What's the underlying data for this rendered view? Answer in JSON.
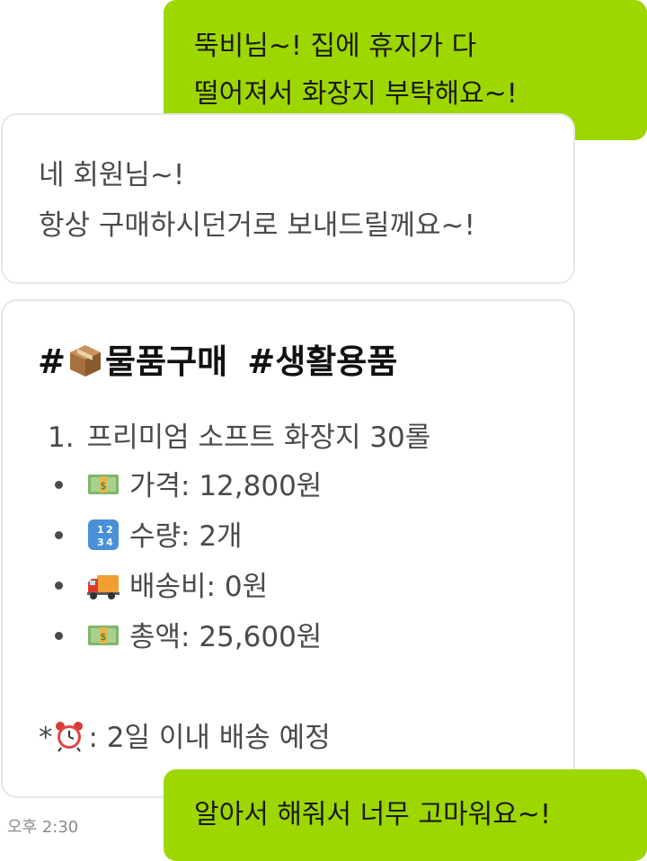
{
  "messages": {
    "outgoing_1": {
      "line1": "뚝비님~! 집에 휴지가 다",
      "line2": "떨어져서 화장지 부탁해요~!"
    },
    "incoming_1": {
      "line1": "네 회원님~!",
      "line2": "항상 구매하시던거로 보내드릴께요~!"
    },
    "order_card": {
      "tag1": "물품구매",
      "tag2": "#생활용품",
      "tag_prefix": "#",
      "item_number": "1.",
      "item_name": "프리미엄 소프트 화장지 30롤",
      "details": [
        {
          "icon": "money-icon",
          "text": "가격: 12,800원"
        },
        {
          "icon": "numbers-icon",
          "text": "수량: 2개"
        },
        {
          "icon": "delivery-truck-icon",
          "text": "배송비: 0원"
        },
        {
          "icon": "money-icon",
          "text": "총액: 25,600원"
        }
      ],
      "note_prefix": "*",
      "note_icon": "alarm-clock-icon",
      "note_text": ": 2일 이내 배송 예정"
    },
    "outgoing_2": {
      "line1": "알아서 해줘서 너무 고마워요~!"
    }
  },
  "timestamp": "오후 2:30",
  "colors": {
    "outgoing_bubble": "#9ed700",
    "incoming_border": "#e6e6e6",
    "incoming_text": "#4a4a4a"
  }
}
